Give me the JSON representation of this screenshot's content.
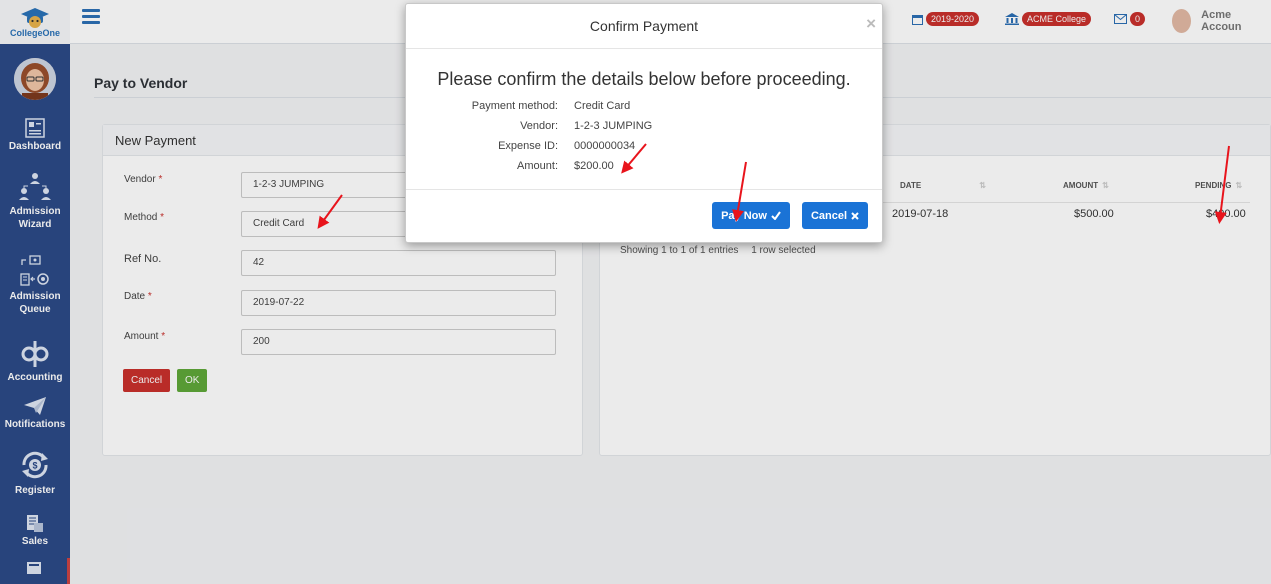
{
  "sidebar": {
    "logo_text": "CollegeOne",
    "items": [
      {
        "label": "Dashboard",
        "icon": "dashboard-icon"
      },
      {
        "label": "Admission Wizard",
        "icon": "people-network-icon"
      },
      {
        "label": "Admission Queue",
        "icon": "queue-icon"
      },
      {
        "label": "Accounting",
        "icon": "quickbooks-icon"
      },
      {
        "label": "Notifications",
        "icon": "paper-plane-icon"
      },
      {
        "label": "Register",
        "icon": "dollar-cycle-icon"
      },
      {
        "label": "Sales",
        "icon": "sales-icon"
      }
    ]
  },
  "topbar": {
    "year_badge": "2019-2020",
    "college_badge": "ACME College",
    "mail_count": "0",
    "user_name": "Acme Accoun"
  },
  "page": {
    "title": "Pay to Vendor"
  },
  "form": {
    "heading": "New Payment",
    "vendor_label": "Vendor",
    "vendor_value": "1-2-3 JUMPING",
    "method_label": "Method",
    "method_value": "Credit Card",
    "ref_label": "Ref No.",
    "ref_value": "42",
    "date_label": "Date",
    "date_value": "2019-07-22",
    "amount_label": "Amount",
    "amount_value": "200",
    "required_mark": "*",
    "cancel_label": "Cancel",
    "ok_label": "OK"
  },
  "table": {
    "columns": [
      "DATE",
      "AMOUNT",
      "PENDING"
    ],
    "row": {
      "date": "2019-07-18",
      "amount": "$500.00",
      "pending": "$400.00"
    },
    "footer": "Showing 1 to 1 of 1 entries",
    "selection_info": "1 row selected"
  },
  "modal": {
    "title": "Confirm Payment",
    "close_glyph": "×",
    "lead": "Please confirm the details below before proceeding.",
    "details": [
      {
        "label": "Payment method:",
        "value": "Credit Card"
      },
      {
        "label": "Vendor:",
        "value": "1-2-3 JUMPING"
      },
      {
        "label": "Expense ID:",
        "value": "0000000034"
      },
      {
        "label": "Amount:",
        "value": "$200.00"
      }
    ],
    "pay_label": "Pay Now",
    "cancel_label": "Cancel"
  },
  "colors": {
    "sidebar_bg": "#2c4a87",
    "primary_blue": "#1a73d6",
    "badge_red": "#c9302c",
    "cancel_red": "#c9302c",
    "ok_green": "#5fa839",
    "annotation_arrow": "#e8141c"
  }
}
